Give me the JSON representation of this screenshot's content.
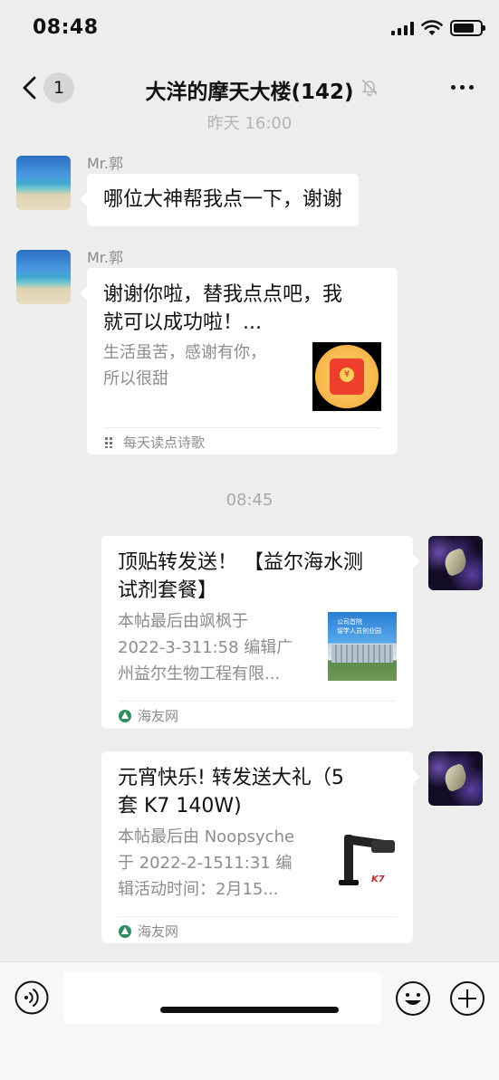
{
  "status_bar": {
    "time": "08:48"
  },
  "nav": {
    "unread_count": "1",
    "title": "大洋的摩天大楼(142)",
    "icons": [
      "chevron-left-icon",
      "bell-mute-icon",
      "more-icon"
    ]
  },
  "time_separators": [
    "昨天 16:00",
    "08:45"
  ],
  "messages": [
    {
      "sender": "Mr.郭",
      "side": "left",
      "type": "text",
      "text": "哪位大神帮我点一下，谢谢"
    },
    {
      "sender": "Mr.郭",
      "side": "left",
      "type": "card",
      "title_lines": [
        "谢谢你啦，替我点点吧，我",
        "就可以成功啦！..."
      ],
      "desc_lines": [
        "生活虽苦，感谢有你，",
        "所以很甜"
      ],
      "source": "每天读点诗歌",
      "thumb": "red-packet"
    },
    {
      "sender": "",
      "side": "right",
      "type": "card",
      "title_lines": [
        "顶贴转发送！ 【益尔海水测",
        "试剂套餐】"
      ],
      "desc_lines": [
        "本帖最后由飒枫于",
        "2022-3-311:58 编辑广",
        "州益尔生物工程有限..."
      ],
      "source": "海友网",
      "thumb": "building",
      "thumb_caption": [
        "公司首院",
        "留学人员创业园"
      ]
    },
    {
      "sender": "",
      "side": "right",
      "type": "card",
      "title_lines": [
        "元宵快乐! 转发送大礼（5",
        "套 K7  140W)"
      ],
      "desc_lines": [
        "本帖最后由 Noopsyche",
        "于 2022-2-1511:31 编",
        "辑活动时间：2月15..."
      ],
      "source": "海友网",
      "thumb": "lamp",
      "thumb_caption": [
        "K7"
      ]
    }
  ],
  "input_bar": {
    "placeholder": "",
    "icons": [
      "voice-icon",
      "emoji-icon",
      "plus-icon"
    ]
  },
  "colors": {
    "background": "#ededed",
    "bubble": "#ffffff",
    "meta_text": "#8c8c8c"
  }
}
